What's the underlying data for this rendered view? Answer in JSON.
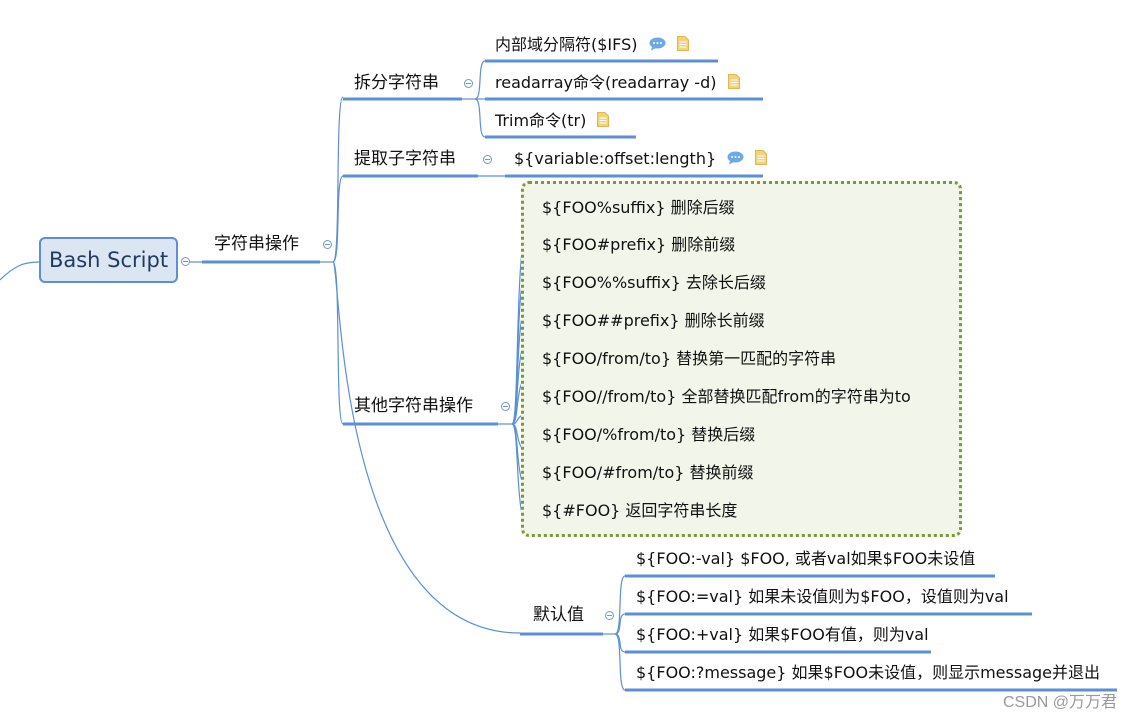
{
  "root": {
    "label": "Bash Script"
  },
  "branch": {
    "label": "字符串操作",
    "children": [
      {
        "label": "拆分字符串",
        "children": [
          {
            "label": "内部域分隔符($IFS)",
            "icons": [
              "comment-icon",
              "note-icon"
            ]
          },
          {
            "label": "readarray命令(readarray -d)",
            "icons": [
              "note-icon"
            ]
          },
          {
            "label": "Trim命令(tr)",
            "icons": [
              "note-icon"
            ]
          }
        ]
      },
      {
        "label": "提取子字符串",
        "children": [
          {
            "label": "${variable:offset:length}",
            "icons": [
              "comment-icon",
              "note-icon"
            ]
          }
        ]
      },
      {
        "label": "其他字符串操作",
        "children": [
          {
            "label": "${FOO%suffix}   删除后缀"
          },
          {
            "label": "${FOO#prefix}   删除前缀"
          },
          {
            "label": "${FOO%%suffix}  去除长后缀"
          },
          {
            "label": "${FOO##prefix}  删除长前缀"
          },
          {
            "label": "${FOO/from/to}  替换第一匹配的字符串"
          },
          {
            "label": "${FOO//from/to} 全部替换匹配from的字符串为to"
          },
          {
            "label": "${FOO/%from/to} 替换后缀"
          },
          {
            "label": "${FOO/#from/to} 替换前缀"
          },
          {
            "label": "${#FOO} 返回字符串长度"
          }
        ]
      },
      {
        "label": "默认值",
        "children": [
          {
            "label": "${FOO:-val} $FOO, 或者val如果$FOO未设值"
          },
          {
            "label": "${FOO:=val} 如果未设值则为$FOO，设值则为val"
          },
          {
            "label": "${FOO:+val} 如果$FOO有值，则为val"
          },
          {
            "label": "${FOO:?message} 如果$FOO未设值，则显示message并退出"
          }
        ]
      }
    ]
  },
  "watermark": "CSDN @万万君",
  "colors": {
    "line": "#5b8fd6",
    "root_fill": "#dce6f3",
    "boundary_border": "#7a9a3a",
    "boundary_fill": "#f2f5ea",
    "comment_icon": "#6fa8e8",
    "note_icon": "#f2d27a"
  }
}
